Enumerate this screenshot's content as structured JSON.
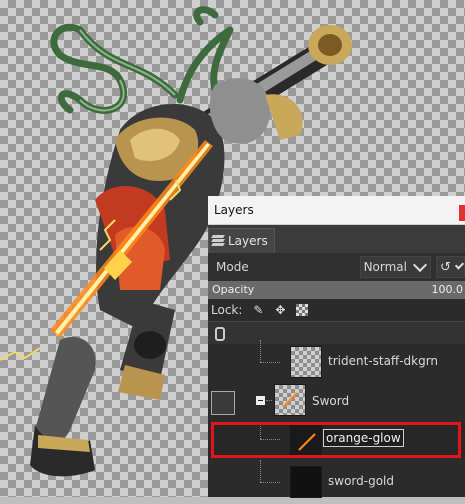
{
  "dock": {
    "title": "Layers",
    "tab_label": "Layers",
    "mode_label": "Mode",
    "mode_value": "Normal",
    "opacity_label": "Opacity",
    "opacity_value": "100.0",
    "lock_label": "Lock:"
  },
  "layers": [
    {
      "name": "trident-staff-dkgrn",
      "indent": 2,
      "type": "layer"
    },
    {
      "name": "Sword",
      "indent": 1,
      "type": "group",
      "expanded": true
    },
    {
      "name": "orange-glow",
      "indent": 2,
      "type": "layer",
      "selected": true,
      "editing": true
    },
    {
      "name": "sword-gold",
      "indent": 2,
      "type": "layer"
    }
  ],
  "colors": {
    "highlight": "#e0161c",
    "panel_bg": "#2b2b2b",
    "glow": "#ff8a1a"
  }
}
